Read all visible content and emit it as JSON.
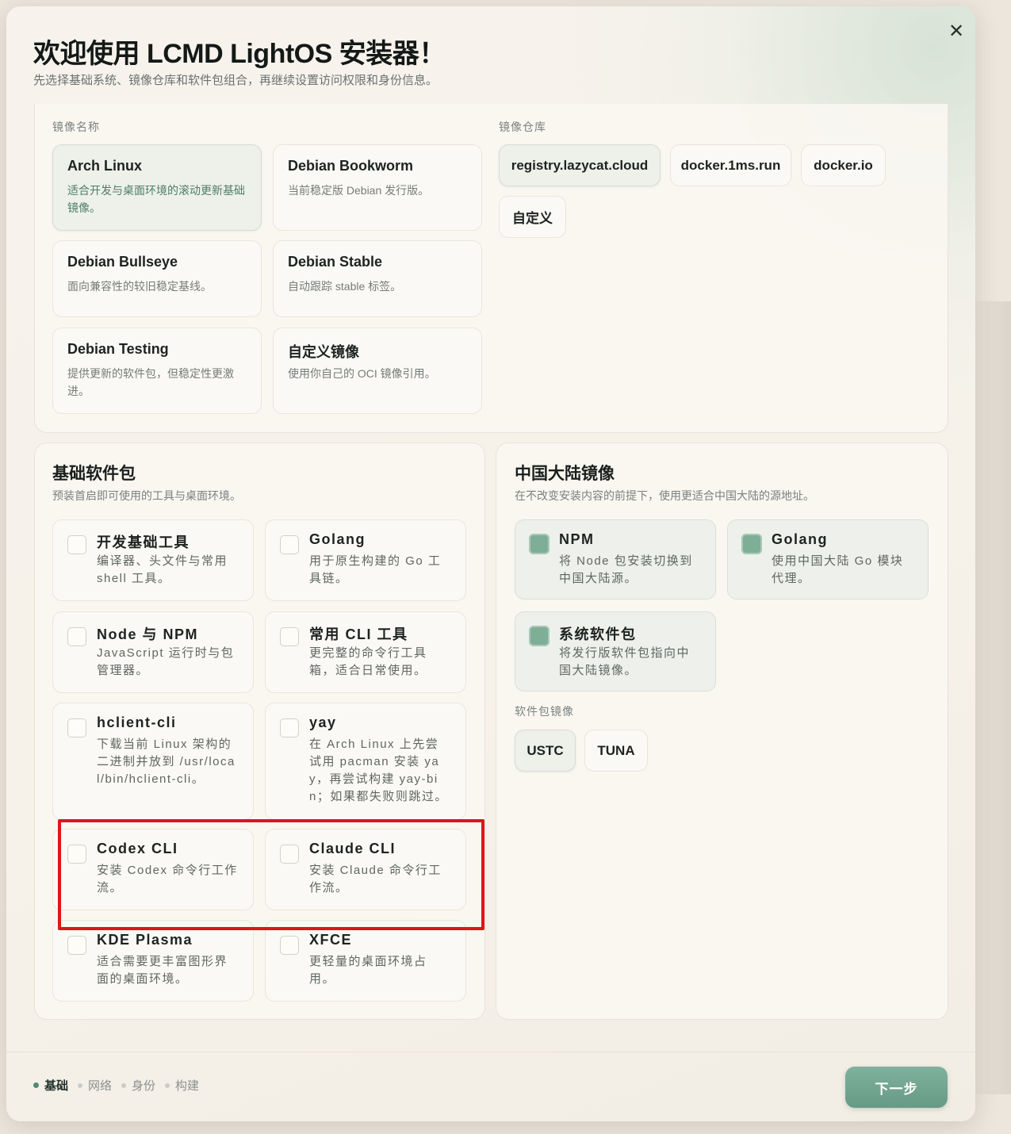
{
  "header": {
    "title": "欢迎使用 LCMD LightOS 安装器！",
    "subtitle": "先选择基础系统、镜像仓库和软件包组合，再继续设置访问权限和身份信息。",
    "close_label": "✕"
  },
  "image_section": {
    "label": "镜像名称",
    "images": [
      {
        "name": "Arch Linux",
        "desc": "适合开发与桌面环境的滚动更新基础镜像。",
        "selected": true
      },
      {
        "name": "Debian Bookworm",
        "desc": "当前稳定版 Debian 发行版。",
        "selected": false
      },
      {
        "name": "Debian Bullseye",
        "desc": "面向兼容性的较旧稳定基线。",
        "selected": false
      },
      {
        "name": "Debian Stable",
        "desc": "自动跟踪 stable 标签。",
        "selected": false
      },
      {
        "name": "Debian Testing",
        "desc": "提供更新的软件包，但稳定性更激进。",
        "selected": false
      },
      {
        "name": "自定义镜像",
        "desc": "使用你自己的 OCI 镜像引用。",
        "selected": false
      }
    ]
  },
  "registry_section": {
    "label": "镜像仓库",
    "registries": [
      {
        "name": "registry.lazycat.cloud",
        "selected": true
      },
      {
        "name": "docker.1ms.run",
        "selected": false
      },
      {
        "name": "docker.io",
        "selected": false
      },
      {
        "name": "自定义",
        "selected": false
      }
    ]
  },
  "packages": {
    "title": "基础软件包",
    "subtitle": "预装首启即可使用的工具与桌面环境。",
    "items": [
      {
        "name": "开发基础工具",
        "desc": "编译器、头文件与常用 shell 工具。",
        "checked": false
      },
      {
        "name": "Golang",
        "desc": "用于原生构建的 Go 工具链。",
        "checked": false
      },
      {
        "name": "Node 与 NPM",
        "desc": "JavaScript 运行时与包管理器。",
        "checked": false
      },
      {
        "name": "常用 CLI 工具",
        "desc": "更完整的命令行工具箱，适合日常使用。",
        "checked": false
      },
      {
        "name": "hclient-cli",
        "desc": "下载当前 Linux 架构的二进制并放到 /usr/local/bin/hclient-cli。",
        "checked": false
      },
      {
        "name": "yay",
        "desc": "在 Arch Linux 上先尝试用 pacman 安装 yay，再尝试构建 yay-bin；如果都失败则跳过。",
        "checked": false
      },
      {
        "name": "Codex CLI",
        "desc": "安装 Codex 命令行工作流。",
        "checked": false
      },
      {
        "name": "Claude CLI",
        "desc": "安装 Claude 命令行工作流。",
        "checked": false
      },
      {
        "name": "KDE Plasma",
        "desc": "适合需要更丰富图形界面的桌面环境。",
        "checked": false
      },
      {
        "name": "XFCE",
        "desc": "更轻量的桌面环境占用。",
        "checked": false
      }
    ]
  },
  "mirrors": {
    "title": "中国大陆镜像",
    "subtitle": "在不改变安装内容的前提下，使用更适合中国大陆的源地址。",
    "items": [
      {
        "name": "NPM",
        "desc": "将 Node 包安装切换到中国大陆源。",
        "checked": true
      },
      {
        "name": "Golang",
        "desc": "使用中国大陆 Go 模块代理。",
        "checked": true
      },
      {
        "name": "系统软件包",
        "desc": "将发行版软件包指向中国大陆镜像。",
        "checked": true
      }
    ],
    "pkg_mirror_label": "软件包镜像",
    "pkg_mirrors": [
      {
        "name": "USTC",
        "selected": true
      },
      {
        "name": "TUNA",
        "selected": false
      }
    ]
  },
  "footer": {
    "steps": [
      {
        "label": "基础",
        "active": true
      },
      {
        "label": "网络",
        "active": false
      },
      {
        "label": "身份",
        "active": false
      },
      {
        "label": "构建",
        "active": false
      }
    ],
    "next_label": "下一步"
  },
  "colors": {
    "accent": "#6fa48f",
    "selected_text": "#4d7e6a",
    "annotation_red": "#e0141c"
  }
}
